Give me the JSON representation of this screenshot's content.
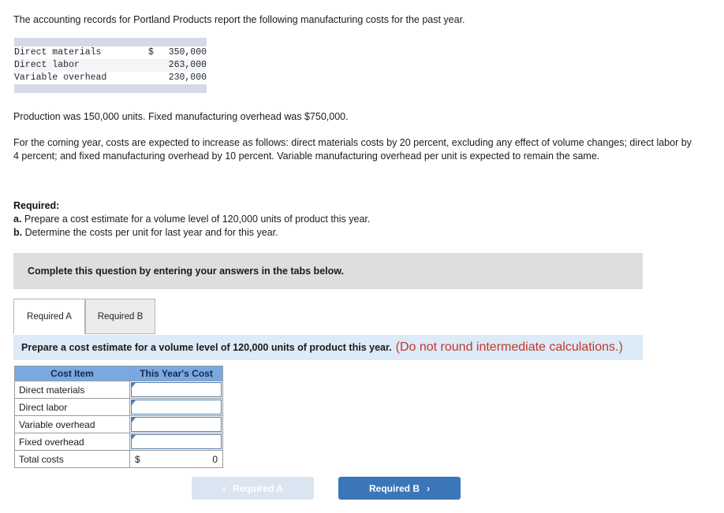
{
  "problem": {
    "intro": "The accounting records for Portland Products report the following manufacturing costs for the past year.",
    "production_note": "Production was 150,000 units. Fixed manufacturing overhead was $750,000.",
    "coming_year": "For the coming year, costs are expected to increase as follows: direct materials costs by 20 percent, excluding any effect of volume changes; direct labor by 4 percent; and fixed manufacturing overhead by 10 percent. Variable manufacturing overhead per unit is expected to remain the same."
  },
  "given_costs": {
    "rows": [
      {
        "label": "Direct materials",
        "currency": "$",
        "amount": "350,000"
      },
      {
        "label": "Direct labor",
        "currency": "",
        "amount": "263,000"
      },
      {
        "label": "Variable overhead",
        "currency": "",
        "amount": "230,000"
      }
    ]
  },
  "required": {
    "heading": "Required:",
    "items": [
      {
        "marker": "a.",
        "text": "Prepare a cost estimate for a volume level of 120,000 units of product this year."
      },
      {
        "marker": "b.",
        "text": "Determine the costs per unit for last year and for this year."
      }
    ]
  },
  "instruction_banner": {
    "text": "Complete this question by entering your answers in the tabs below."
  },
  "tabs": [
    {
      "label": "Required A",
      "active": true
    },
    {
      "label": "Required B",
      "active": false
    }
  ],
  "sub_instruction": {
    "text": "Prepare a cost estimate for a volume level of 120,000 units of product this year.",
    "note": "(Do not round intermediate calculations.)",
    "note_color": "#c0392b"
  },
  "answer_table": {
    "headers": [
      "Cost Item",
      "This Year's Cost"
    ],
    "rows": [
      {
        "label": "Direct materials",
        "type": "input",
        "value": ""
      },
      {
        "label": "Direct labor",
        "type": "input",
        "value": ""
      },
      {
        "label": "Variable overhead",
        "type": "input",
        "value": ""
      },
      {
        "label": "Fixed overhead",
        "type": "input",
        "value": ""
      },
      {
        "label": "Total costs",
        "type": "total",
        "currency": "$",
        "value": "0"
      }
    ]
  },
  "navigation": {
    "prev_label": "Required A",
    "prev_icon": "chevron-left-icon",
    "prev_glyph": "‹",
    "next_label": "Required B",
    "next_icon": "chevron-right-icon",
    "next_glyph": "›",
    "prev_color": "#dbe5f1",
    "next_color": "#3a76b8"
  }
}
